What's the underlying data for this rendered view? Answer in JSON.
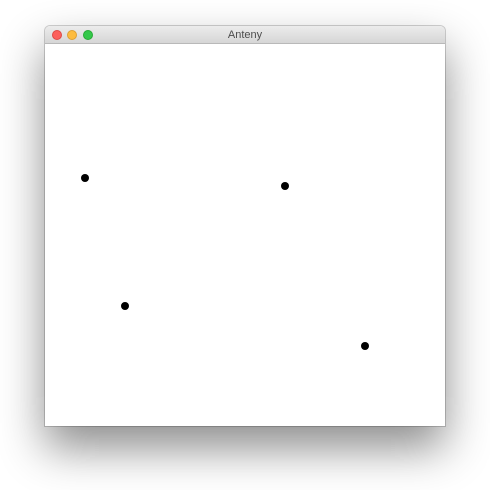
{
  "window": {
    "title": "Anteny",
    "traffic_lights": [
      {
        "name": "close",
        "color": "#fc605c"
      },
      {
        "name": "minimize",
        "color": "#fdbc40"
      },
      {
        "name": "maximize",
        "color": "#34c84a"
      }
    ]
  },
  "canvas": {
    "background": "#ffffff",
    "point_color": "#000000",
    "point_count": 4
  }
}
